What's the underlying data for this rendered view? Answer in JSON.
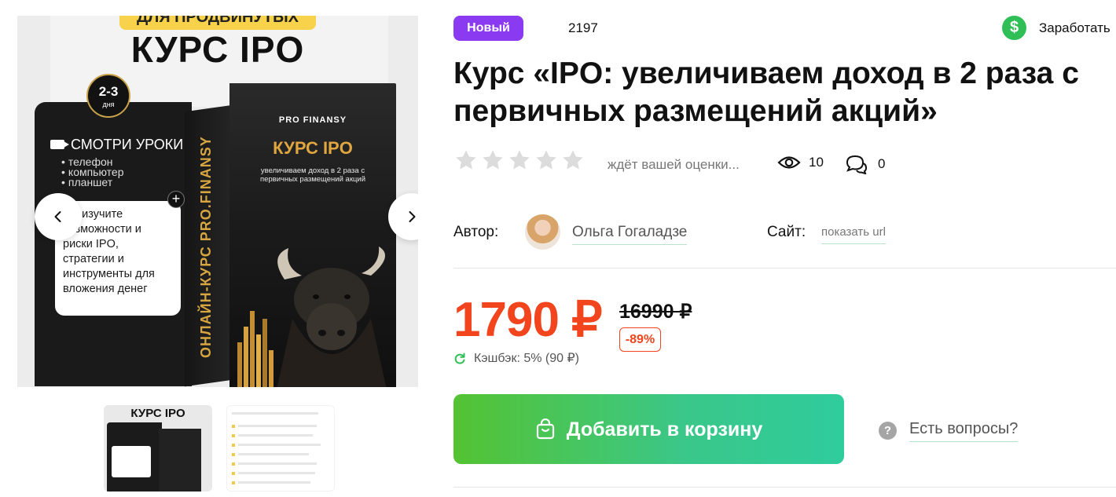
{
  "gallery": {
    "promo": {
      "badge": "ДЛЯ ПРОДВИНУТЫХ",
      "title": "КУРС IPO",
      "days_num": "2-3",
      "days_unit": "дня",
      "lessons_heading": "СМОТРИ УРОКИ",
      "devices": [
        "телефон",
        "компьютер",
        "планшет"
      ],
      "card_text": "Вы изучите возможности и риски IPO, стратегии и инструменты для вложения денег",
      "box_brand": "PRO FINANSY",
      "box_title": "КУРС IPO",
      "box_subtitle": "увеличиваем доход в 2 раза с первичных размещений акций",
      "box_spine": "ОНЛАЙН-КУРС PRO.FINANSY"
    },
    "thumb1_title": "КУРС IPO",
    "nav_prev_icon": "chevron-left-icon",
    "nav_next_icon": "chevron-right-icon"
  },
  "product": {
    "badge": "Новый",
    "id": "2197",
    "earn_label": "Заработать",
    "title": "Курс «IPO: увеличиваем доход в 2 раза с первичных размещений акций»",
    "rating_text": "ждёт вашей оценки...",
    "rating_value": 0,
    "rating_max": 5,
    "views": "10",
    "comments": "0",
    "author_label": "Автор:",
    "author_name": "Ольга Гогаладзе",
    "site_label": "Сайт:",
    "site_link": "показать url",
    "price": "1790 ₽",
    "old_price": "16990 ₽",
    "discount": "-89%",
    "cashback": "Кэшбэк: 5% (90 ₽)",
    "cart_button": "Добавить в корзину",
    "questions_link": "Есть вопросы?"
  },
  "colors": {
    "badge_new": "#8a3bf1",
    "price": "#f2441d",
    "cart_gradient_start": "#54c332",
    "cart_gradient_end": "#2fcc9c",
    "earn_icon": "#2fbf56"
  }
}
